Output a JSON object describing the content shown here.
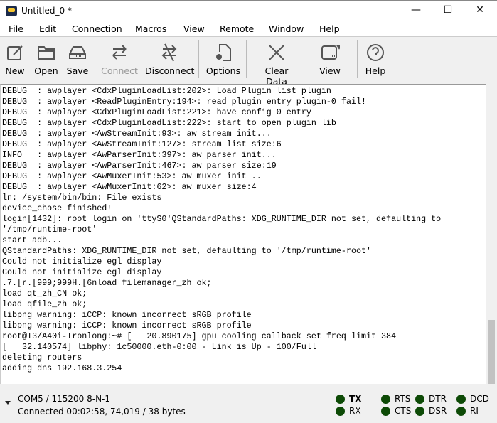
{
  "window": {
    "title": "Untitled_0 *",
    "minimize": "—",
    "maximize": "☐",
    "close": "✕"
  },
  "menu": [
    "File",
    "Edit",
    "Connection",
    "Macros",
    "View",
    "Remote",
    "Window",
    "Help"
  ],
  "toolbar": {
    "new": "New",
    "open": "Open",
    "save": "Save",
    "connect": "Connect",
    "disconnect": "Disconnect",
    "options": "Options",
    "clear": "Clear Data",
    "view": "View",
    "help": "Help"
  },
  "terminal": {
    "lines": [
      "DEBUG  : awplayer <CdxPluginLoadList:202>: Load Plugin list plugin",
      "DEBUG  : awplayer <ReadPluginEntry:194>: read plugin entry plugin-0 fail!",
      "DEBUG  : awplayer <CdxPluginLoadList:221>: have config 0 entry",
      "DEBUG  : awplayer <CdxPluginLoadList:222>: start to open plugin lib",
      "DEBUG  : awplayer <AwStreamInit:93>: aw stream init...",
      "DEBUG  : awplayer <AwStreamInit:127>: stream list size:6",
      "INFO   : awplayer <AwParserInit:397>: aw parser init...",
      "DEBUG  : awplayer <AwParserInit:467>: aw parser size:19",
      "DEBUG  : awplayer <AwMuxerInit:53>: aw muxer init ..",
      "DEBUG  : awplayer <AwMuxerInit:62>: aw muxer size:4",
      "ln: /system/bin/bin: File exists",
      "device_chose finished!",
      "login[1432]: root login on 'ttyS0'QStandardPaths: XDG_RUNTIME_DIR not set, defaulting to",
      "'/tmp/runtime-root'",
      "start adb...",
      "QStandardPaths: XDG_RUNTIME_DIR not set, defaulting to '/tmp/runtime-root'",
      "Could not initialize egl display",
      "Could not initialize egl display",
      ".7.[r.[999;999H.[6nload filemanager_zh ok;",
      "load qt_zh_CN ok;",
      "load qfile_zh ok;",
      "libpng warning: iCCP: known incorrect sRGB profile",
      "libpng warning: iCCP: known incorrect sRGB profile",
      "root@T3/A40i-Tronlong:~# [   20.890175] gpu cooling callback set freq limit 384",
      "[   32.140574] libphy: 1c50000.eth-0:00 - Link is Up - 100/Full",
      "deleting routers",
      "adding dns 192.168.3.254"
    ]
  },
  "status": {
    "port": "COM5 / 115200 8-N-1",
    "connection": "Connected 00:02:58, 74,019 / 38 bytes",
    "signals": [
      "TX",
      "RX",
      "RTS",
      "CTS",
      "DTR",
      "DSR",
      "DCD",
      "RI"
    ],
    "led_color": "#0d4a06"
  }
}
